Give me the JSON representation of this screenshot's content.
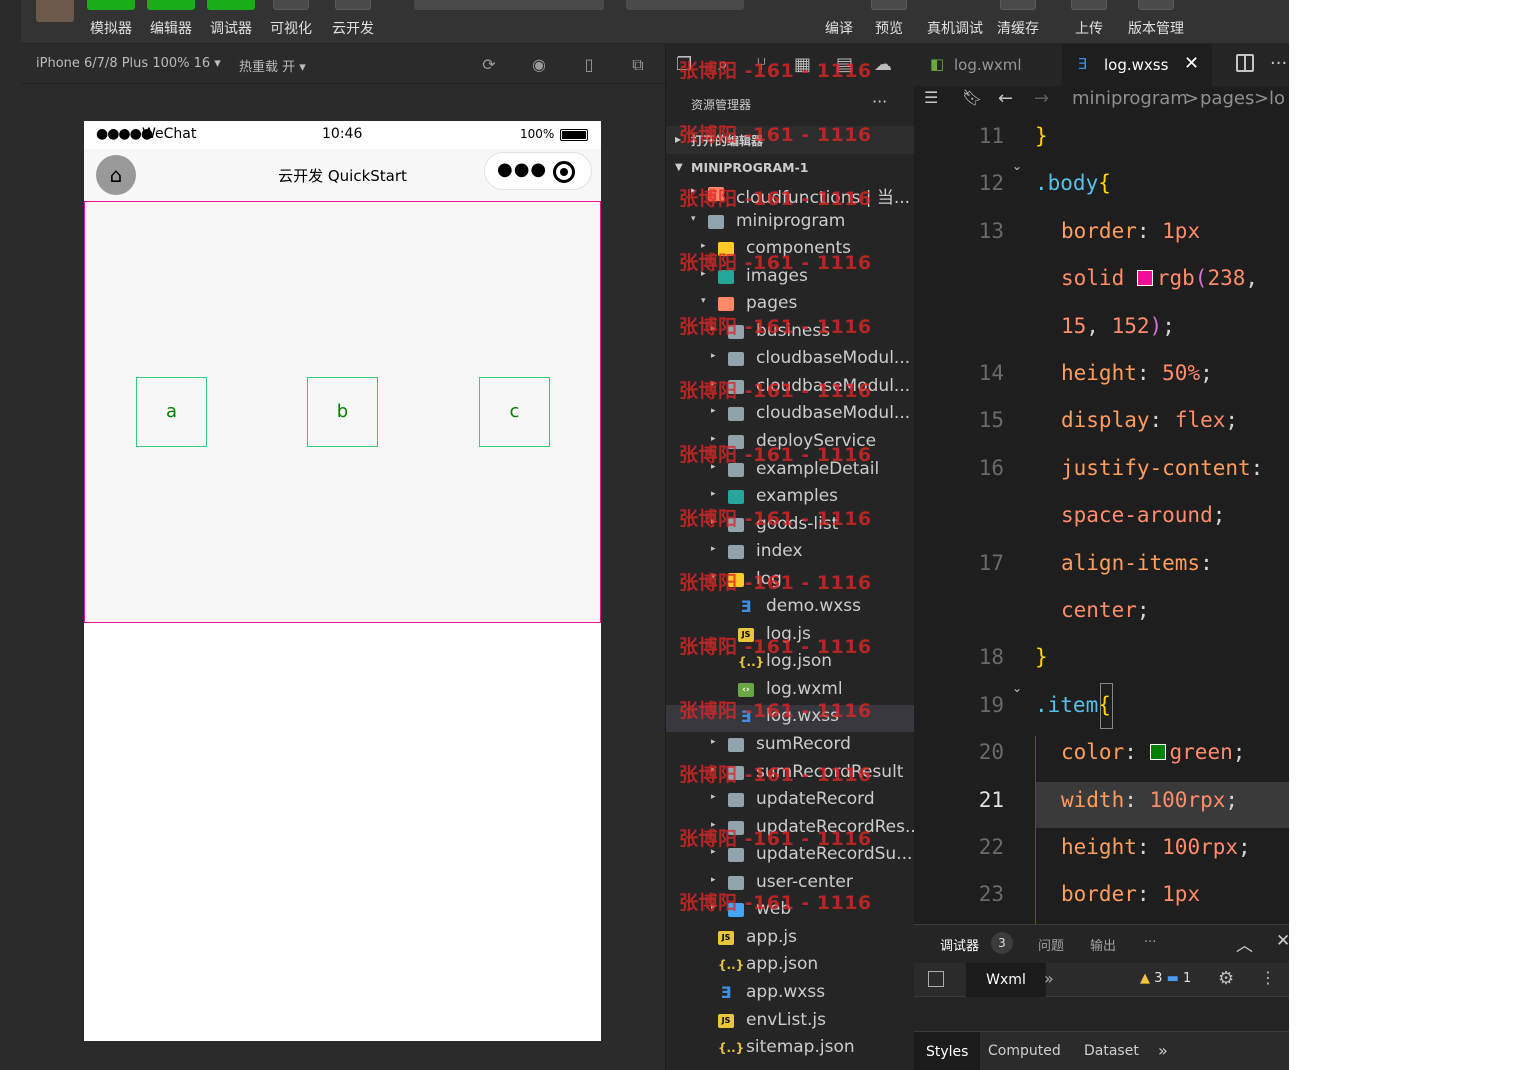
{
  "toolbar": {
    "buttons": [
      "模拟器",
      "编辑器",
      "调试器",
      "可视化",
      "云开发"
    ],
    "right_buttons": [
      "编译",
      "预览",
      "真机调试",
      "清缓存",
      "上传",
      "版本管理"
    ]
  },
  "simulator": {
    "device": "iPhone 6/7/8 Plus 100% 16 ▾",
    "hot_reload": "热重载 开 ▾",
    "status": {
      "signal": "●●●●●",
      "carrier": "WeChat",
      "time": "10:46",
      "battery": "100%"
    },
    "nav_title": "云开发 QuickStart",
    "items": [
      "a",
      "b",
      "c"
    ]
  },
  "explorer": {
    "title": "资源管理器",
    "open_editors": "打开的编辑器",
    "root": "MINIPROGRAM-1",
    "tree": [
      {
        "name": "cloudfunctions | 当...",
        "depth": 0,
        "tw": "▸",
        "icon": "folder-orange",
        "glyph": ""
      },
      {
        "name": "miniprogram",
        "depth": 0,
        "tw": "▾",
        "icon": "folder",
        "glyph": ""
      },
      {
        "name": "components",
        "depth": 1,
        "tw": "▸",
        "icon": "folder-yellow",
        "glyph": ""
      },
      {
        "name": "images",
        "depth": 1,
        "tw": "▸",
        "icon": "folder-teal",
        "glyph": ""
      },
      {
        "name": "pages",
        "depth": 1,
        "tw": "▾",
        "icon": "folder-orange",
        "glyph": ""
      },
      {
        "name": "business",
        "depth": 2,
        "tw": "▸",
        "icon": "folder",
        "glyph": ""
      },
      {
        "name": "cloudbaseModul...",
        "depth": 2,
        "tw": "▸",
        "icon": "folder",
        "glyph": ""
      },
      {
        "name": "cloudbaseModul...",
        "depth": 2,
        "tw": "▸",
        "icon": "folder",
        "glyph": ""
      },
      {
        "name": "cloudbaseModul...",
        "depth": 2,
        "tw": "▸",
        "icon": "folder",
        "glyph": ""
      },
      {
        "name": "deployService",
        "depth": 2,
        "tw": "▸",
        "icon": "folder",
        "glyph": ""
      },
      {
        "name": "exampleDetail",
        "depth": 2,
        "tw": "▸",
        "icon": "folder",
        "glyph": ""
      },
      {
        "name": "examples",
        "depth": 2,
        "tw": "▸",
        "icon": "folder-teal",
        "glyph": ""
      },
      {
        "name": "goods-list",
        "depth": 2,
        "tw": "▸",
        "icon": "folder",
        "glyph": ""
      },
      {
        "name": "index",
        "depth": 2,
        "tw": "▸",
        "icon": "folder",
        "glyph": ""
      },
      {
        "name": "log",
        "depth": 2,
        "tw": "▾",
        "icon": "folder-yellow",
        "glyph": ""
      },
      {
        "name": "demo.wxss",
        "depth": 3,
        "tw": "",
        "icon": "css",
        "glyph": "Ǝ"
      },
      {
        "name": "log.js",
        "depth": 3,
        "tw": "",
        "icon": "js",
        "glyph": "JS"
      },
      {
        "name": "log.json",
        "depth": 3,
        "tw": "",
        "icon": "json",
        "glyph": "{..}"
      },
      {
        "name": "log.wxml",
        "depth": 3,
        "tw": "",
        "icon": "wxml",
        "glyph": "‹›"
      },
      {
        "name": "log.wxss",
        "depth": 3,
        "tw": "",
        "icon": "css",
        "glyph": "Ǝ",
        "active": true
      },
      {
        "name": "sumRecord",
        "depth": 2,
        "tw": "▸",
        "icon": "folder",
        "glyph": ""
      },
      {
        "name": "sumRecordResult",
        "depth": 2,
        "tw": "▸",
        "icon": "folder",
        "glyph": ""
      },
      {
        "name": "updateRecord",
        "depth": 2,
        "tw": "▸",
        "icon": "folder",
        "glyph": ""
      },
      {
        "name": "updateRecordRes...",
        "depth": 2,
        "tw": "▸",
        "icon": "folder",
        "glyph": ""
      },
      {
        "name": "updateRecordSu...",
        "depth": 2,
        "tw": "▸",
        "icon": "folder",
        "glyph": ""
      },
      {
        "name": "user-center",
        "depth": 2,
        "tw": "▸",
        "icon": "folder",
        "glyph": ""
      },
      {
        "name": "web",
        "depth": 2,
        "tw": "▸",
        "icon": "folder-blue",
        "glyph": ""
      },
      {
        "name": "app.js",
        "depth": 1,
        "tw": "",
        "icon": "js",
        "glyph": "JS"
      },
      {
        "name": "app.json",
        "depth": 1,
        "tw": "",
        "icon": "json",
        "glyph": "{..}"
      },
      {
        "name": "app.wxss",
        "depth": 1,
        "tw": "",
        "icon": "css",
        "glyph": "Ǝ"
      },
      {
        "name": "envList.js",
        "depth": 1,
        "tw": "",
        "icon": "js",
        "glyph": "JS"
      },
      {
        "name": "sitemap.json",
        "depth": 1,
        "tw": "",
        "icon": "json",
        "glyph": "{..}"
      }
    ],
    "watermark": "张博阳 -161 - 1116"
  },
  "editor": {
    "tabs": [
      "log.wxml",
      "log.wxss"
    ],
    "breadcrumb": [
      "miniprogram",
      ">",
      "pages",
      ">",
      "lo"
    ],
    "lines": [
      {
        "n": "11",
        "parts": [
          [
            "}",
            "brace"
          ]
        ],
        "indent": 0
      },
      {
        "n": "12",
        "parts": [
          [
            ".body",
            "sel"
          ],
          [
            "{",
            "brace"
          ]
        ],
        "indent": 0,
        "fold": true
      },
      {
        "n": "13",
        "parts": [
          [
            "border",
            "prop"
          ],
          [
            ": ",
            "punc"
          ],
          [
            "1px",
            "num"
          ]
        ],
        "indent": 1
      },
      {
        "n": "",
        "parts": [
          [
            "solid ",
            "val"
          ],
          [
            "SW:rgb(238,15,152)",
            "swatch"
          ],
          [
            "rgb",
            "val"
          ],
          [
            "(",
            "paren"
          ],
          [
            "238",
            "num"
          ],
          [
            ",",
            "punc"
          ]
        ],
        "indent": 1
      },
      {
        "n": "",
        "parts": [
          [
            "15",
            "num"
          ],
          [
            ", ",
            "punc"
          ],
          [
            "152",
            "num"
          ],
          [
            ")",
            "paren"
          ],
          [
            ";",
            "punc"
          ]
        ],
        "indent": 1
      },
      {
        "n": "14",
        "parts": [
          [
            "height",
            "prop"
          ],
          [
            ": ",
            "punc"
          ],
          [
            "50%",
            "num"
          ],
          [
            ";",
            "punc"
          ]
        ],
        "indent": 1
      },
      {
        "n": "15",
        "parts": [
          [
            "display",
            "prop"
          ],
          [
            ": ",
            "punc"
          ],
          [
            "flex",
            "val"
          ],
          [
            ";",
            "punc"
          ]
        ],
        "indent": 1
      },
      {
        "n": "16",
        "parts": [
          [
            "justify-content",
            "prop"
          ],
          [
            ":",
            "punc"
          ]
        ],
        "indent": 1
      },
      {
        "n": "",
        "parts": [
          [
            "space-around",
            "val"
          ],
          [
            ";",
            "punc"
          ]
        ],
        "indent": 1
      },
      {
        "n": "17",
        "parts": [
          [
            "align-items",
            "prop"
          ],
          [
            ":",
            "punc"
          ]
        ],
        "indent": 1
      },
      {
        "n": "",
        "parts": [
          [
            "center",
            "val"
          ],
          [
            ";",
            "punc"
          ]
        ],
        "indent": 1
      },
      {
        "n": "18",
        "parts": [
          [
            "}",
            "brace"
          ]
        ],
        "indent": 0
      },
      {
        "n": "19",
        "parts": [
          [
            ".item",
            "sel"
          ],
          [
            "{",
            "brace"
          ]
        ],
        "indent": 0,
        "fold": true
      },
      {
        "n": "20",
        "parts": [
          [
            "color",
            "prop"
          ],
          [
            ": ",
            "punc"
          ],
          [
            "SW:green",
            "swatch"
          ],
          [
            "green",
            "val"
          ],
          [
            ";",
            "punc"
          ]
        ],
        "indent": 1
      },
      {
        "n": "21",
        "parts": [
          [
            "width",
            "prop"
          ],
          [
            ": ",
            "punc"
          ],
          [
            "100",
            "num"
          ],
          [
            "rpx",
            "val"
          ],
          [
            ";",
            "punc"
          ]
        ],
        "indent": 1,
        "current": true
      },
      {
        "n": "22",
        "parts": [
          [
            "height",
            "prop"
          ],
          [
            ": ",
            "punc"
          ],
          [
            "100",
            "num"
          ],
          [
            "rpx",
            "val"
          ],
          [
            ";",
            "punc"
          ]
        ],
        "indent": 1
      },
      {
        "n": "23",
        "parts": [
          [
            "border",
            "prop"
          ],
          [
            ": ",
            "punc"
          ],
          [
            "1px",
            "num"
          ]
        ],
        "indent": 1
      }
    ]
  },
  "debugger": {
    "tabs": [
      "调试器",
      "问题",
      "输出"
    ],
    "count": "3",
    "more": "···",
    "panel": "Wxml",
    "warn_count": "3",
    "msg_count": "1",
    "style_tabs": [
      "Styles",
      "Computed",
      "Dataset"
    ]
  }
}
